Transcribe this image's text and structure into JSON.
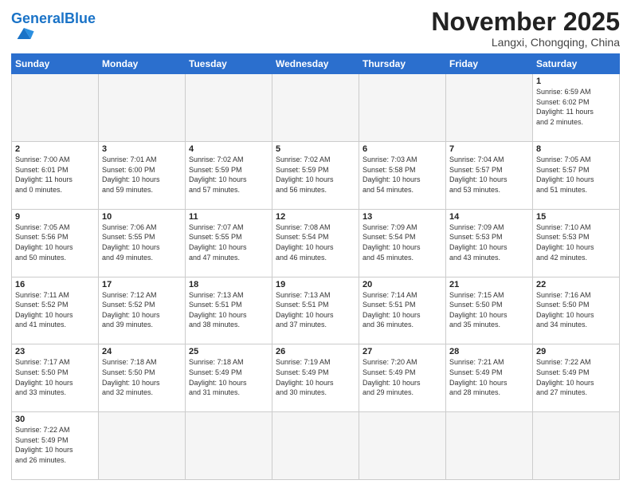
{
  "header": {
    "logo_general": "General",
    "logo_blue": "Blue",
    "month_title": "November 2025",
    "location": "Langxi, Chongqing, China"
  },
  "weekdays": [
    "Sunday",
    "Monday",
    "Tuesday",
    "Wednesday",
    "Thursday",
    "Friday",
    "Saturday"
  ],
  "weeks": [
    [
      {
        "day": "",
        "info": "",
        "empty": true
      },
      {
        "day": "",
        "info": "",
        "empty": true
      },
      {
        "day": "",
        "info": "",
        "empty": true
      },
      {
        "day": "",
        "info": "",
        "empty": true
      },
      {
        "day": "",
        "info": "",
        "empty": true
      },
      {
        "day": "",
        "info": "",
        "empty": true
      },
      {
        "day": "1",
        "info": "Sunrise: 6:59 AM\nSunset: 6:02 PM\nDaylight: 11 hours\nand 2 minutes."
      }
    ],
    [
      {
        "day": "2",
        "info": "Sunrise: 7:00 AM\nSunset: 6:01 PM\nDaylight: 11 hours\nand 0 minutes."
      },
      {
        "day": "3",
        "info": "Sunrise: 7:01 AM\nSunset: 6:00 PM\nDaylight: 10 hours\nand 59 minutes."
      },
      {
        "day": "4",
        "info": "Sunrise: 7:02 AM\nSunset: 5:59 PM\nDaylight: 10 hours\nand 57 minutes."
      },
      {
        "day": "5",
        "info": "Sunrise: 7:02 AM\nSunset: 5:59 PM\nDaylight: 10 hours\nand 56 minutes."
      },
      {
        "day": "6",
        "info": "Sunrise: 7:03 AM\nSunset: 5:58 PM\nDaylight: 10 hours\nand 54 minutes."
      },
      {
        "day": "7",
        "info": "Sunrise: 7:04 AM\nSunset: 5:57 PM\nDaylight: 10 hours\nand 53 minutes."
      },
      {
        "day": "8",
        "info": "Sunrise: 7:05 AM\nSunset: 5:57 PM\nDaylight: 10 hours\nand 51 minutes."
      }
    ],
    [
      {
        "day": "9",
        "info": "Sunrise: 7:05 AM\nSunset: 5:56 PM\nDaylight: 10 hours\nand 50 minutes."
      },
      {
        "day": "10",
        "info": "Sunrise: 7:06 AM\nSunset: 5:55 PM\nDaylight: 10 hours\nand 49 minutes."
      },
      {
        "day": "11",
        "info": "Sunrise: 7:07 AM\nSunset: 5:55 PM\nDaylight: 10 hours\nand 47 minutes."
      },
      {
        "day": "12",
        "info": "Sunrise: 7:08 AM\nSunset: 5:54 PM\nDaylight: 10 hours\nand 46 minutes."
      },
      {
        "day": "13",
        "info": "Sunrise: 7:09 AM\nSunset: 5:54 PM\nDaylight: 10 hours\nand 45 minutes."
      },
      {
        "day": "14",
        "info": "Sunrise: 7:09 AM\nSunset: 5:53 PM\nDaylight: 10 hours\nand 43 minutes."
      },
      {
        "day": "15",
        "info": "Sunrise: 7:10 AM\nSunset: 5:53 PM\nDaylight: 10 hours\nand 42 minutes."
      }
    ],
    [
      {
        "day": "16",
        "info": "Sunrise: 7:11 AM\nSunset: 5:52 PM\nDaylight: 10 hours\nand 41 minutes."
      },
      {
        "day": "17",
        "info": "Sunrise: 7:12 AM\nSunset: 5:52 PM\nDaylight: 10 hours\nand 39 minutes."
      },
      {
        "day": "18",
        "info": "Sunrise: 7:13 AM\nSunset: 5:51 PM\nDaylight: 10 hours\nand 38 minutes."
      },
      {
        "day": "19",
        "info": "Sunrise: 7:13 AM\nSunset: 5:51 PM\nDaylight: 10 hours\nand 37 minutes."
      },
      {
        "day": "20",
        "info": "Sunrise: 7:14 AM\nSunset: 5:51 PM\nDaylight: 10 hours\nand 36 minutes."
      },
      {
        "day": "21",
        "info": "Sunrise: 7:15 AM\nSunset: 5:50 PM\nDaylight: 10 hours\nand 35 minutes."
      },
      {
        "day": "22",
        "info": "Sunrise: 7:16 AM\nSunset: 5:50 PM\nDaylight: 10 hours\nand 34 minutes."
      }
    ],
    [
      {
        "day": "23",
        "info": "Sunrise: 7:17 AM\nSunset: 5:50 PM\nDaylight: 10 hours\nand 33 minutes."
      },
      {
        "day": "24",
        "info": "Sunrise: 7:18 AM\nSunset: 5:50 PM\nDaylight: 10 hours\nand 32 minutes."
      },
      {
        "day": "25",
        "info": "Sunrise: 7:18 AM\nSunset: 5:49 PM\nDaylight: 10 hours\nand 31 minutes."
      },
      {
        "day": "26",
        "info": "Sunrise: 7:19 AM\nSunset: 5:49 PM\nDaylight: 10 hours\nand 30 minutes."
      },
      {
        "day": "27",
        "info": "Sunrise: 7:20 AM\nSunset: 5:49 PM\nDaylight: 10 hours\nand 29 minutes."
      },
      {
        "day": "28",
        "info": "Sunrise: 7:21 AM\nSunset: 5:49 PM\nDaylight: 10 hours\nand 28 minutes."
      },
      {
        "day": "29",
        "info": "Sunrise: 7:22 AM\nSunset: 5:49 PM\nDaylight: 10 hours\nand 27 minutes."
      }
    ],
    [
      {
        "day": "30",
        "info": "Sunrise: 7:22 AM\nSunset: 5:49 PM\nDaylight: 10 hours\nand 26 minutes."
      },
      {
        "day": "",
        "info": "",
        "empty": true
      },
      {
        "day": "",
        "info": "",
        "empty": true
      },
      {
        "day": "",
        "info": "",
        "empty": true
      },
      {
        "day": "",
        "info": "",
        "empty": true
      },
      {
        "day": "",
        "info": "",
        "empty": true
      },
      {
        "day": "",
        "info": "",
        "empty": true
      }
    ]
  ]
}
